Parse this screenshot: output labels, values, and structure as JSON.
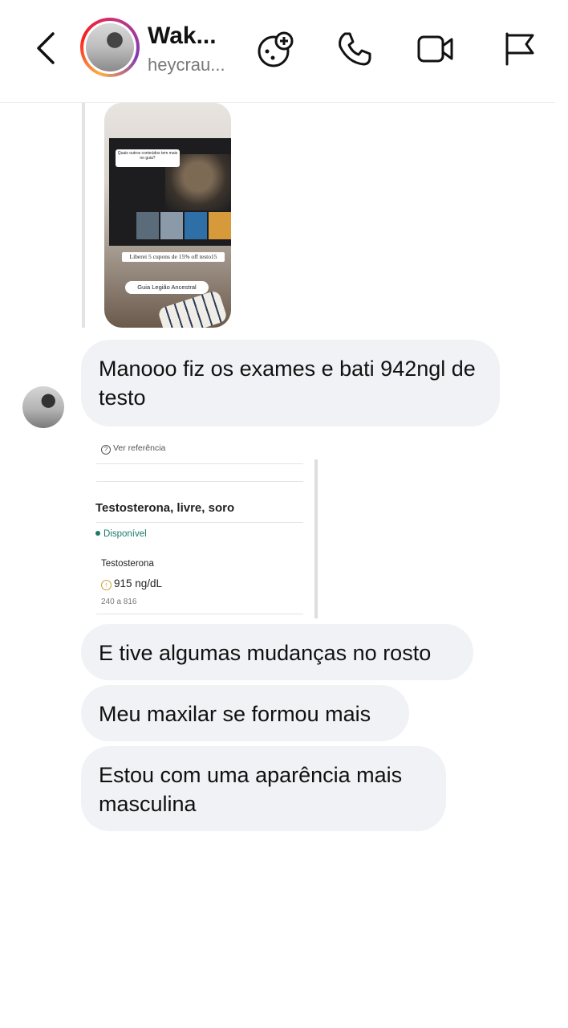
{
  "header": {
    "name": "Wak...",
    "username": "heycrau...",
    "icons": [
      "back-icon",
      "game-icon",
      "phone-icon",
      "video-icon",
      "flag-icon"
    ]
  },
  "story": {
    "question": "Quais outros conteúdos tem mais no guia?",
    "sticker": "Liberei 5 cupons de 15% off testo15",
    "link": "Guia Legião Ancestral"
  },
  "messages": [
    {
      "text": "Manooo fiz os exames e bati 942ngl de testo"
    },
    {
      "text": "E tive algumas mudanças no rosto"
    },
    {
      "text": "Meu maxilar se formou mais"
    },
    {
      "text": "Estou com uma aparência mais masculina"
    }
  ],
  "exam": {
    "ref_label": "Ver referência",
    "title": "Testosterona, livre, soro",
    "status": "Disponível",
    "test_name": "Testosterona",
    "value": "915 ng/dL",
    "range": "240 a 816"
  },
  "colors": {
    "bubble_bg": "#f0f2f5",
    "status_green": "#1a7a6a",
    "username_gray": "#7a7a7a"
  }
}
